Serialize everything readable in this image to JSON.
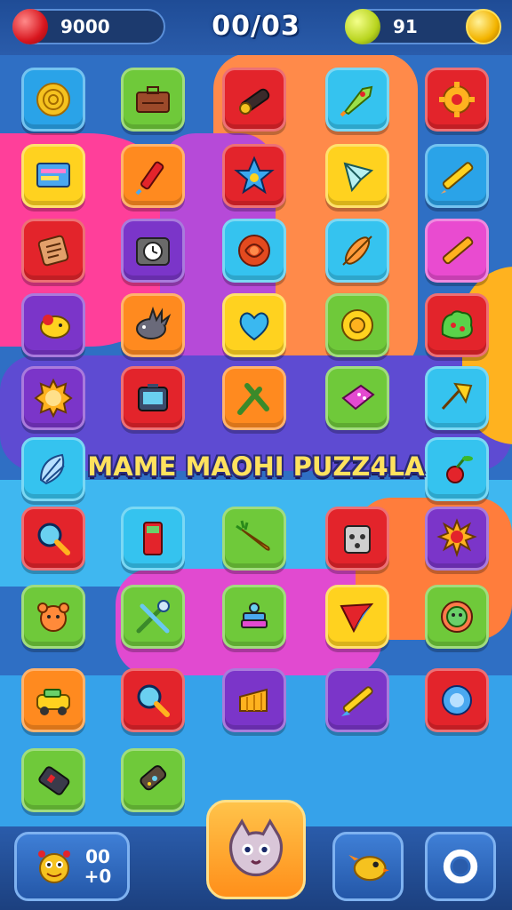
{
  "colors": {
    "red": "#e3242b",
    "green": "#6fc93a",
    "blue": "#2aa3e8",
    "yellow": "#ffd21f",
    "orange": "#ff8a1f",
    "purple": "#7b35c9",
    "pink": "#e94bd0",
    "lightblue": "#35c3ef"
  },
  "hud": {
    "score": "9000",
    "timer": "00/03",
    "coins": "91",
    "score_icon": "red-gem-icon",
    "coin_icon": "gold-coin-icon"
  },
  "title": "MAME MAOHI PUZZ4LA",
  "grid": [
    {
      "icon": "coin-icon",
      "color": "blue"
    },
    {
      "icon": "briefcase-icon",
      "color": "green"
    },
    {
      "icon": "cannon-icon",
      "color": "red"
    },
    {
      "icon": "rocket-icon",
      "color": "lightblue"
    },
    {
      "icon": "gear-icon",
      "color": "red"
    },
    {
      "icon": "screen-icon",
      "color": "yellow"
    },
    {
      "icon": "firework-icon",
      "color": "orange"
    },
    {
      "icon": "star-icon",
      "color": "red"
    },
    {
      "icon": "kite-icon",
      "color": "yellow"
    },
    {
      "icon": "pencil-icon",
      "color": "blue"
    },
    {
      "icon": "block-icon",
      "color": "red"
    },
    {
      "icon": "clock-icon",
      "color": "purple"
    },
    {
      "icon": "rose-icon",
      "color": "lightblue"
    },
    {
      "icon": "paddle-icon",
      "color": "lightblue"
    },
    {
      "icon": "crayon-icon",
      "color": "pink"
    },
    {
      "icon": "creature-icon",
      "color": "purple"
    },
    {
      "icon": "hedgehog-icon",
      "color": "orange"
    },
    {
      "icon": "heart-icon",
      "color": "yellow"
    },
    {
      "icon": "disc-icon",
      "color": "green"
    },
    {
      "icon": "slime-icon",
      "color": "red"
    },
    {
      "icon": "sun-face-icon",
      "color": "purple"
    },
    {
      "icon": "tv-icon",
      "color": "red"
    },
    {
      "icon": "wrench-icon",
      "color": "orange"
    },
    {
      "icon": "eraser-icon",
      "color": "green"
    },
    {
      "icon": "umbrella-icon",
      "color": "lightblue"
    },
    {
      "icon": "shell-icon",
      "color": "lightblue"
    },
    {
      "icon": "cherry-icon",
      "color": "lightblue"
    },
    {
      "icon": "magnifier-icon",
      "color": "red"
    },
    {
      "icon": "phone-icon",
      "color": "lightblue"
    },
    {
      "icon": "carrot-icon",
      "color": "green"
    },
    {
      "icon": "robot-icon",
      "color": "red"
    },
    {
      "icon": "sunflower-icon",
      "color": "purple"
    },
    {
      "icon": "bear-icon",
      "color": "green"
    },
    {
      "icon": "tools-icon",
      "color": "green"
    },
    {
      "icon": "stack-icon",
      "color": "green"
    },
    {
      "icon": "arrow-icon",
      "color": "yellow"
    },
    {
      "icon": "face-icon",
      "color": "green"
    },
    {
      "icon": "car-icon",
      "color": "orange"
    },
    {
      "icon": "magnifier-icon",
      "color": "red"
    },
    {
      "icon": "cheese-icon",
      "color": "purple"
    },
    {
      "icon": "brush-icon",
      "color": "purple"
    },
    {
      "icon": "gem-icon",
      "color": "red"
    },
    {
      "icon": "battery-icon",
      "color": "green"
    },
    {
      "icon": "remote-icon",
      "color": "green"
    }
  ],
  "bottom": {
    "counter_top": "00",
    "counter_bottom": "+0",
    "left_icon": "monster-icon",
    "center_icon": "cat-icon",
    "right_icon": "bird-icon",
    "settings_icon": "ring-icon"
  }
}
